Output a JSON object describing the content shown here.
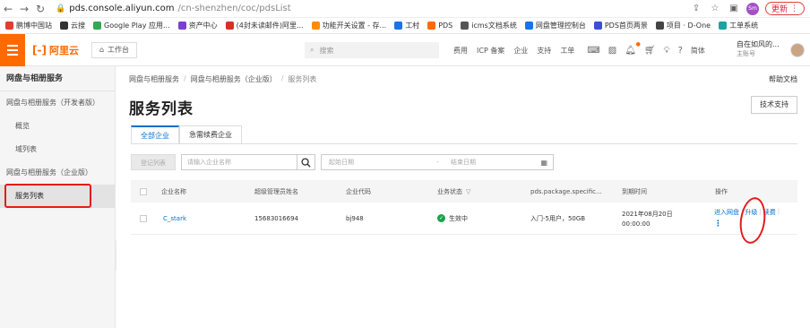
{
  "browser": {
    "url_host": "pds.console.aliyun.com",
    "url_path": "/cn-shenzhen/coc/pdsList",
    "update_label": "更新",
    "profile_badge": "Sm"
  },
  "bookmarks": [
    {
      "label": "鹏博中国站",
      "color": "#e33b2e"
    },
    {
      "label": "云搜",
      "color": "#333333"
    },
    {
      "label": "Google Play 应用...",
      "color": "#34a853"
    },
    {
      "label": "资产中心",
      "color": "#7a3fd0"
    },
    {
      "label": "(4封未读邮件)阿里...",
      "color": "#d93025"
    },
    {
      "label": "功能开关设置 - 存...",
      "color": "#ff8c00"
    },
    {
      "label": "工村",
      "color": "#1a73e8"
    },
    {
      "label": "PDS",
      "color": "#ff6a00"
    },
    {
      "label": "icms文档系统",
      "color": "#555555"
    },
    {
      "label": "网盘管理控制台",
      "color": "#1a73e8"
    },
    {
      "label": "PDS首页两景",
      "color": "#3b4fd8"
    },
    {
      "label": "项目 · D-One",
      "color": "#444444"
    },
    {
      "label": "工单系统",
      "color": "#1aa3a3"
    }
  ],
  "topnav": {
    "logo_mark": "[-]",
    "logo_text": "阿里云",
    "workbench": "工作台",
    "search_placeholder": "搜索",
    "menu": [
      "费用",
      "ICP 备案",
      "企业",
      "支持",
      "工单"
    ],
    "lang": "简体",
    "user_name": "自在如风的...",
    "user_sub": "主账号"
  },
  "sidebar": {
    "title": "网盘与相册服务",
    "group1": "网盘与相册服务（开发者版）",
    "items1": [
      "概览",
      "域列表"
    ],
    "group2": "网盘与相册服务（企业版）",
    "items2": [
      "服务列表"
    ]
  },
  "main": {
    "breadcrumb": [
      "网盘与相册服务",
      "网盘与相册服务（企业版）",
      "服务列表"
    ],
    "help": "帮助文档",
    "title": "服务列表",
    "tech_support": "技术支持",
    "tabs": [
      "全部企业",
      "急需续费企业"
    ],
    "filters": {
      "register_btn": "登记列表",
      "search_placeholder": "请输入企业名称",
      "start_date": "起始日期",
      "dash": "-",
      "end_date": "结束日期"
    },
    "table": {
      "headers": [
        "企业名称",
        "超级管理员姓名",
        "企业代码",
        "业务状态",
        "pds.package.specific...",
        "到期时间",
        "操作"
      ],
      "rows": [
        {
          "name": "C_stark",
          "admin": "15683016694",
          "code": "bj948",
          "status": "生效中",
          "package": "入门-5用户，50GB",
          "expire_date": "2021年08月20日",
          "expire_time": "00:00:00",
          "op_enter": "进入网盘",
          "op_upgrade": "升级",
          "op_renew": "续费",
          "op_more": "⋮"
        }
      ]
    }
  }
}
